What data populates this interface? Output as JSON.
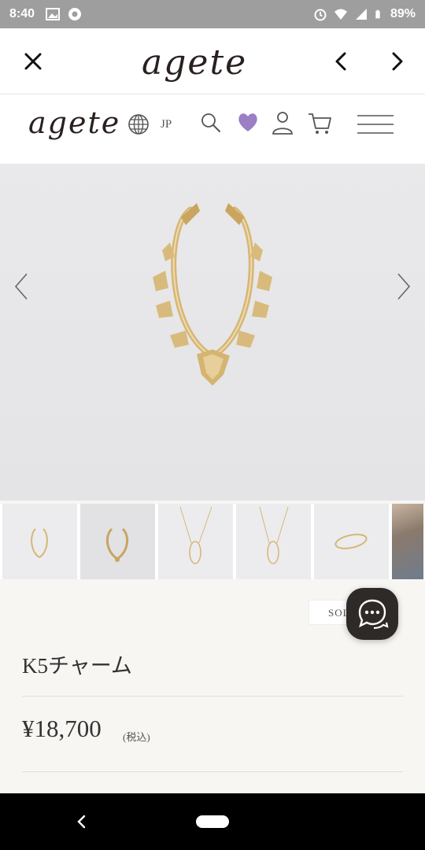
{
  "status_bar": {
    "time": "8:40",
    "battery": "89%",
    "icons": [
      "gallery-icon",
      "chrome-icon",
      "alarm-icon",
      "wifi-icon",
      "signal-icon",
      "battery-icon"
    ]
  },
  "chrome_bar": {
    "logo": "agete",
    "icons": [
      "close-icon",
      "chevron-left-icon",
      "chevron-right-icon"
    ]
  },
  "site_header": {
    "logo": "agete",
    "language": "JP",
    "icons": [
      "globe-icon",
      "search-icon",
      "heart-icon",
      "user-icon",
      "cart-icon",
      "menu-icon"
    ],
    "heart_color": "#9b7fc4"
  },
  "hero": {
    "icons": [
      "chevron-left-icon",
      "chevron-right-icon"
    ],
    "gold_color": "#d6b676"
  },
  "thumbnails": {
    "count": 6,
    "active_index": 1
  },
  "product": {
    "badge": "SOLD OUT",
    "name": "K5チャーム",
    "price": "¥18,700",
    "tax_note": "(税込)"
  },
  "chat": {
    "icon": "chat-icon"
  },
  "nav_bar": {
    "icons": [
      "back-icon",
      "home-pill"
    ]
  }
}
